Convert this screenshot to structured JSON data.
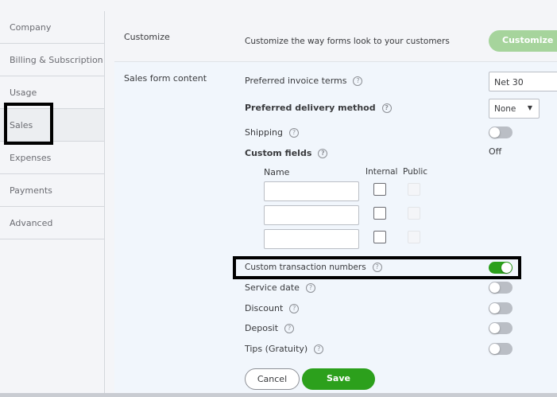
{
  "sidebar": {
    "items": [
      {
        "label": "Company"
      },
      {
        "label": "Billing & Subscription"
      },
      {
        "label": "Usage"
      },
      {
        "label": "Sales",
        "active": true
      },
      {
        "label": "Expenses"
      },
      {
        "label": "Payments"
      },
      {
        "label": "Advanced"
      }
    ]
  },
  "customize": {
    "section": "Customize",
    "description": "Customize the way forms look to your customers",
    "button": "Customize lo"
  },
  "sales_form": {
    "section": "Sales form content",
    "invoice_terms": {
      "label": "Preferred invoice terms",
      "value": "Net 30"
    },
    "delivery": {
      "label": "Preferred delivery method",
      "value": "None"
    },
    "shipping": {
      "label": "Shipping",
      "on": false
    },
    "custom_fields": {
      "label": "Custom fields",
      "status": "Off",
      "col_name": "Name",
      "col_internal": "Internal",
      "col_public": "Public"
    },
    "custom_txn": {
      "label": "Custom transaction numbers",
      "on": true
    },
    "service_date": {
      "label": "Service date",
      "on": false
    },
    "discount": {
      "label": "Discount",
      "on": false
    },
    "deposit": {
      "label": "Deposit",
      "on": false
    },
    "tips": {
      "label": "Tips (Gratuity)",
      "on": false
    }
  },
  "help_glyph": "?",
  "buttons": {
    "cancel": "Cancel",
    "save": "Save"
  },
  "colors": {
    "green": "#2ca01c",
    "light_green": "#a6d49c"
  }
}
